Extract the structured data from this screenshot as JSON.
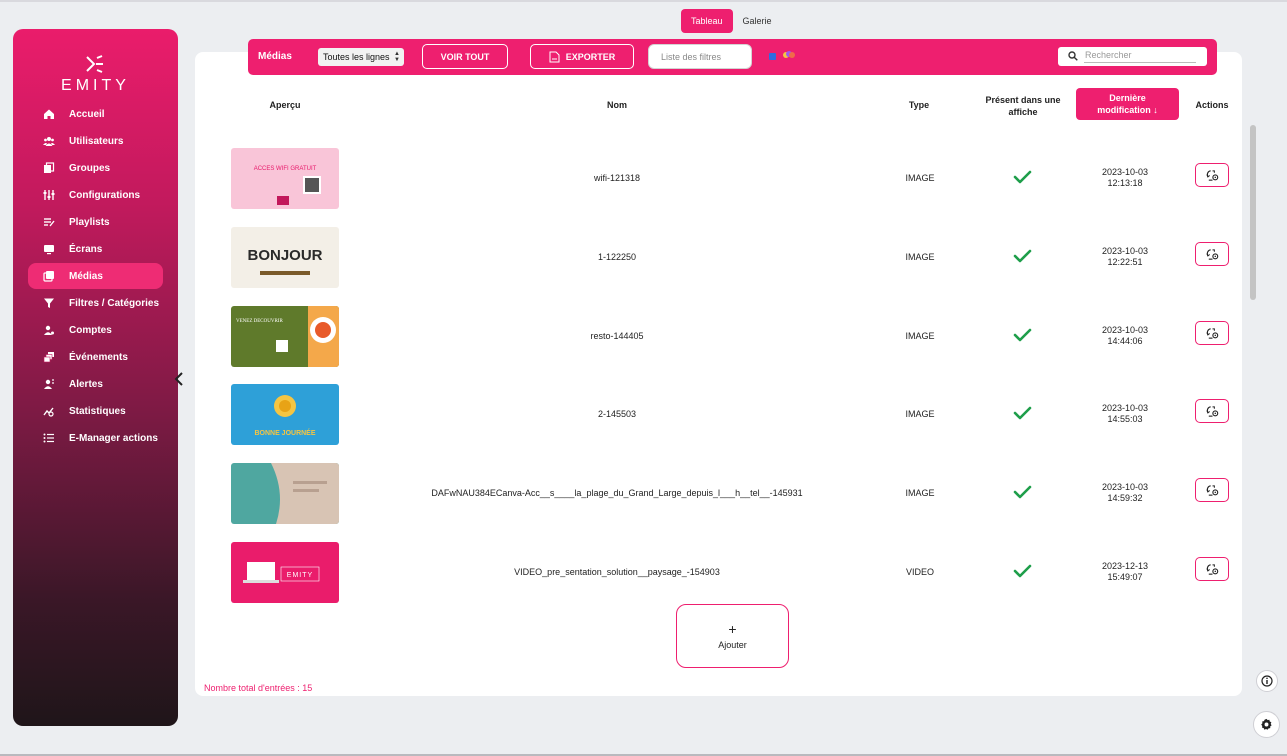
{
  "brand": {
    "name": "EMITY"
  },
  "view_tabs": [
    {
      "label": "Tableau",
      "active": true
    },
    {
      "label": "Galerie",
      "active": false
    }
  ],
  "sidebar": {
    "items": [
      {
        "label": "Accueil",
        "icon": "home-icon"
      },
      {
        "label": "Utilisateurs",
        "icon": "users-icon"
      },
      {
        "label": "Groupes",
        "icon": "groups-icon"
      },
      {
        "label": "Configurations",
        "icon": "sliders-icon"
      },
      {
        "label": "Playlists",
        "icon": "playlist-icon"
      },
      {
        "label": "Écrans",
        "icon": "screen-icon"
      },
      {
        "label": "Médias",
        "icon": "media-icon",
        "active": true
      },
      {
        "label": "Filtres / Catégories",
        "icon": "filter-icon"
      },
      {
        "label": "Comptes",
        "icon": "accounts-icon"
      },
      {
        "label": "Événements",
        "icon": "events-icon"
      },
      {
        "label": "Alertes",
        "icon": "alerts-icon"
      },
      {
        "label": "Statistiques",
        "icon": "stats-icon"
      },
      {
        "label": "E-Manager actions",
        "icon": "list-icon"
      }
    ]
  },
  "toolbar": {
    "title": "Médias",
    "lines_select": "Toutes les lignes",
    "voir_tout": "VOIR TOUT",
    "export": "EXPORTER",
    "filter_placeholder": "Liste des filtres",
    "search_placeholder": "Rechercher"
  },
  "table": {
    "headers": {
      "preview": "Aperçu",
      "name": "Nom",
      "type": "Type",
      "present_line1": "Présent dans une",
      "present_line2": "affiche",
      "modified_line1": "Dernière",
      "modified_line2": "modification ↓",
      "actions": "Actions"
    },
    "rows": [
      {
        "name": "wifi-121318",
        "type": "IMAGE",
        "present": true,
        "date": "2023-10-03",
        "time": "12:13:18",
        "thumb_bg": "#f9c5d8",
        "thumb_text": "ACCES WIFI GRATUIT"
      },
      {
        "name": "1-122250",
        "type": "IMAGE",
        "present": true,
        "date": "2023-10-03",
        "time": "12:22:51",
        "thumb_bg": "#f3efe7",
        "thumb_text": "BONJOUR"
      },
      {
        "name": "resto-144405",
        "type": "IMAGE",
        "present": true,
        "date": "2023-10-03",
        "time": "14:44:06",
        "thumb_bg": "#5f7a2b",
        "thumb_text": "VENEZ DECOUVRIR"
      },
      {
        "name": "2-145503",
        "type": "IMAGE",
        "present": true,
        "date": "2023-10-03",
        "time": "14:55:03",
        "thumb_bg": "#2ea0d8",
        "thumb_text": "BONNE JOURNÉE"
      },
      {
        "name": "DAFwNAU384ECanva-Acc__s____la_plage_du_Grand_Large_depuis_l___h__tel__-145931",
        "type": "IMAGE",
        "present": true,
        "date": "2023-10-03",
        "time": "14:59:32",
        "thumb_bg": "#4fa7a0",
        "thumb_text": ""
      },
      {
        "name": "VIDEO_pre_sentation_solution__paysage_-154903",
        "type": "VIDEO",
        "present": true,
        "date": "2023-12-13",
        "time": "15:49:07",
        "thumb_bg": "#ea1c6b",
        "thumb_text": "EMITY"
      }
    ]
  },
  "add_button": {
    "plus": "+",
    "label": "Ajouter"
  },
  "total": "Nombre total d'entrées : 15",
  "colors": {
    "accent": "#ee1f6f",
    "check": "#1e9e4a"
  }
}
